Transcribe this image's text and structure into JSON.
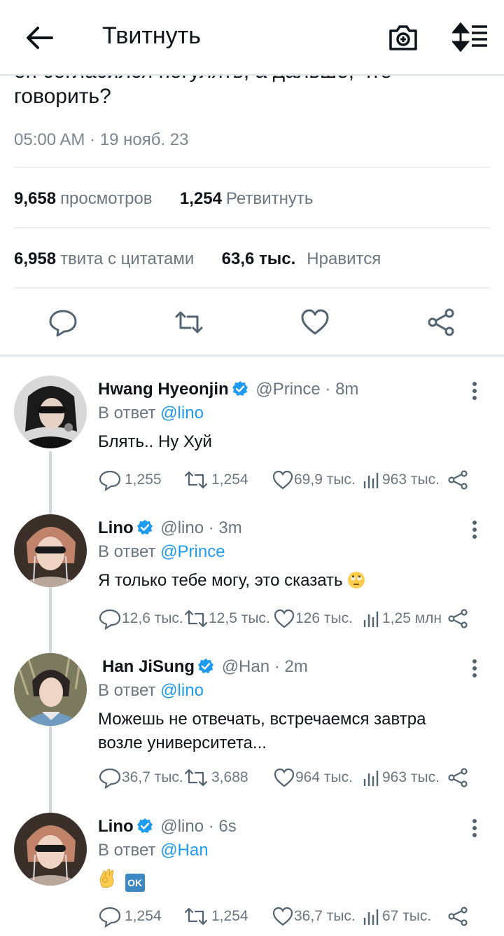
{
  "header": {
    "title": "Твитнуть",
    "back_icon": "arrow-left-icon",
    "camera_icon": "camera-plus-icon",
    "sort_icon": "sort-list-icon"
  },
  "tweet": {
    "text_cut": "оп согласился погулять, а дальше, что",
    "text": "говорить?",
    "timestamp": "05:00 AM · 19 нояб. 23",
    "views_count": "9,658",
    "views_label": "просмотров",
    "retweets_count": "1,254",
    "retweets_label": "Ретвитнуть",
    "quotes_count": "6,958",
    "quotes_label": "твита с цитатами",
    "likes_count": "63,6 тыс.",
    "likes_label": "Нравится"
  },
  "colors": {
    "accent": "#1d9bf0",
    "muted": "#6a7680",
    "text": "#0f1419"
  },
  "replies": [
    {
      "name": "Hwang Hyeonjin",
      "handle": "@Prince · 8m",
      "reply_prefix": "В ответ",
      "reply_to": "@lino",
      "text": "Блять.. Ну Хуй",
      "comments": "1,255",
      "retweets": "1,254",
      "likes": "69,9 тыс.",
      "views": "963 тыс."
    },
    {
      "name": "Lino",
      "handle": "@lino · 3m",
      "reply_prefix": "В ответ",
      "reply_to": "@Prince",
      "text": "Я только тебе могу, это сказать",
      "emoji": "eye-roll-emoji",
      "comments": "12,6 тыс.",
      "retweets": "12,5 тыс.",
      "likes": "126 тыс.",
      "views": "1,25 млн"
    },
    {
      "name": "Han JiSung",
      "handle": "@Han · 2m",
      "reply_prefix": "В ответ",
      "reply_to": "@lino",
      "text_line1": "Можешь не отвечать, встречаемся завтра",
      "text_line2": "возле университета...",
      "comments": "36,7 тыс.",
      "retweets": "3,688",
      "likes": "964 тыс.",
      "views": "963 тыс."
    },
    {
      "name": "Lino",
      "handle": "@lino · 6s",
      "reply_prefix": "В ответ",
      "reply_to": "@Han",
      "ok_badge": "OK",
      "emoji": "ok-hand-emoji",
      "comments": "1,254",
      "retweets": "1,254",
      "likes": "36,7 тыс.",
      "views": "67 тыс."
    }
  ]
}
